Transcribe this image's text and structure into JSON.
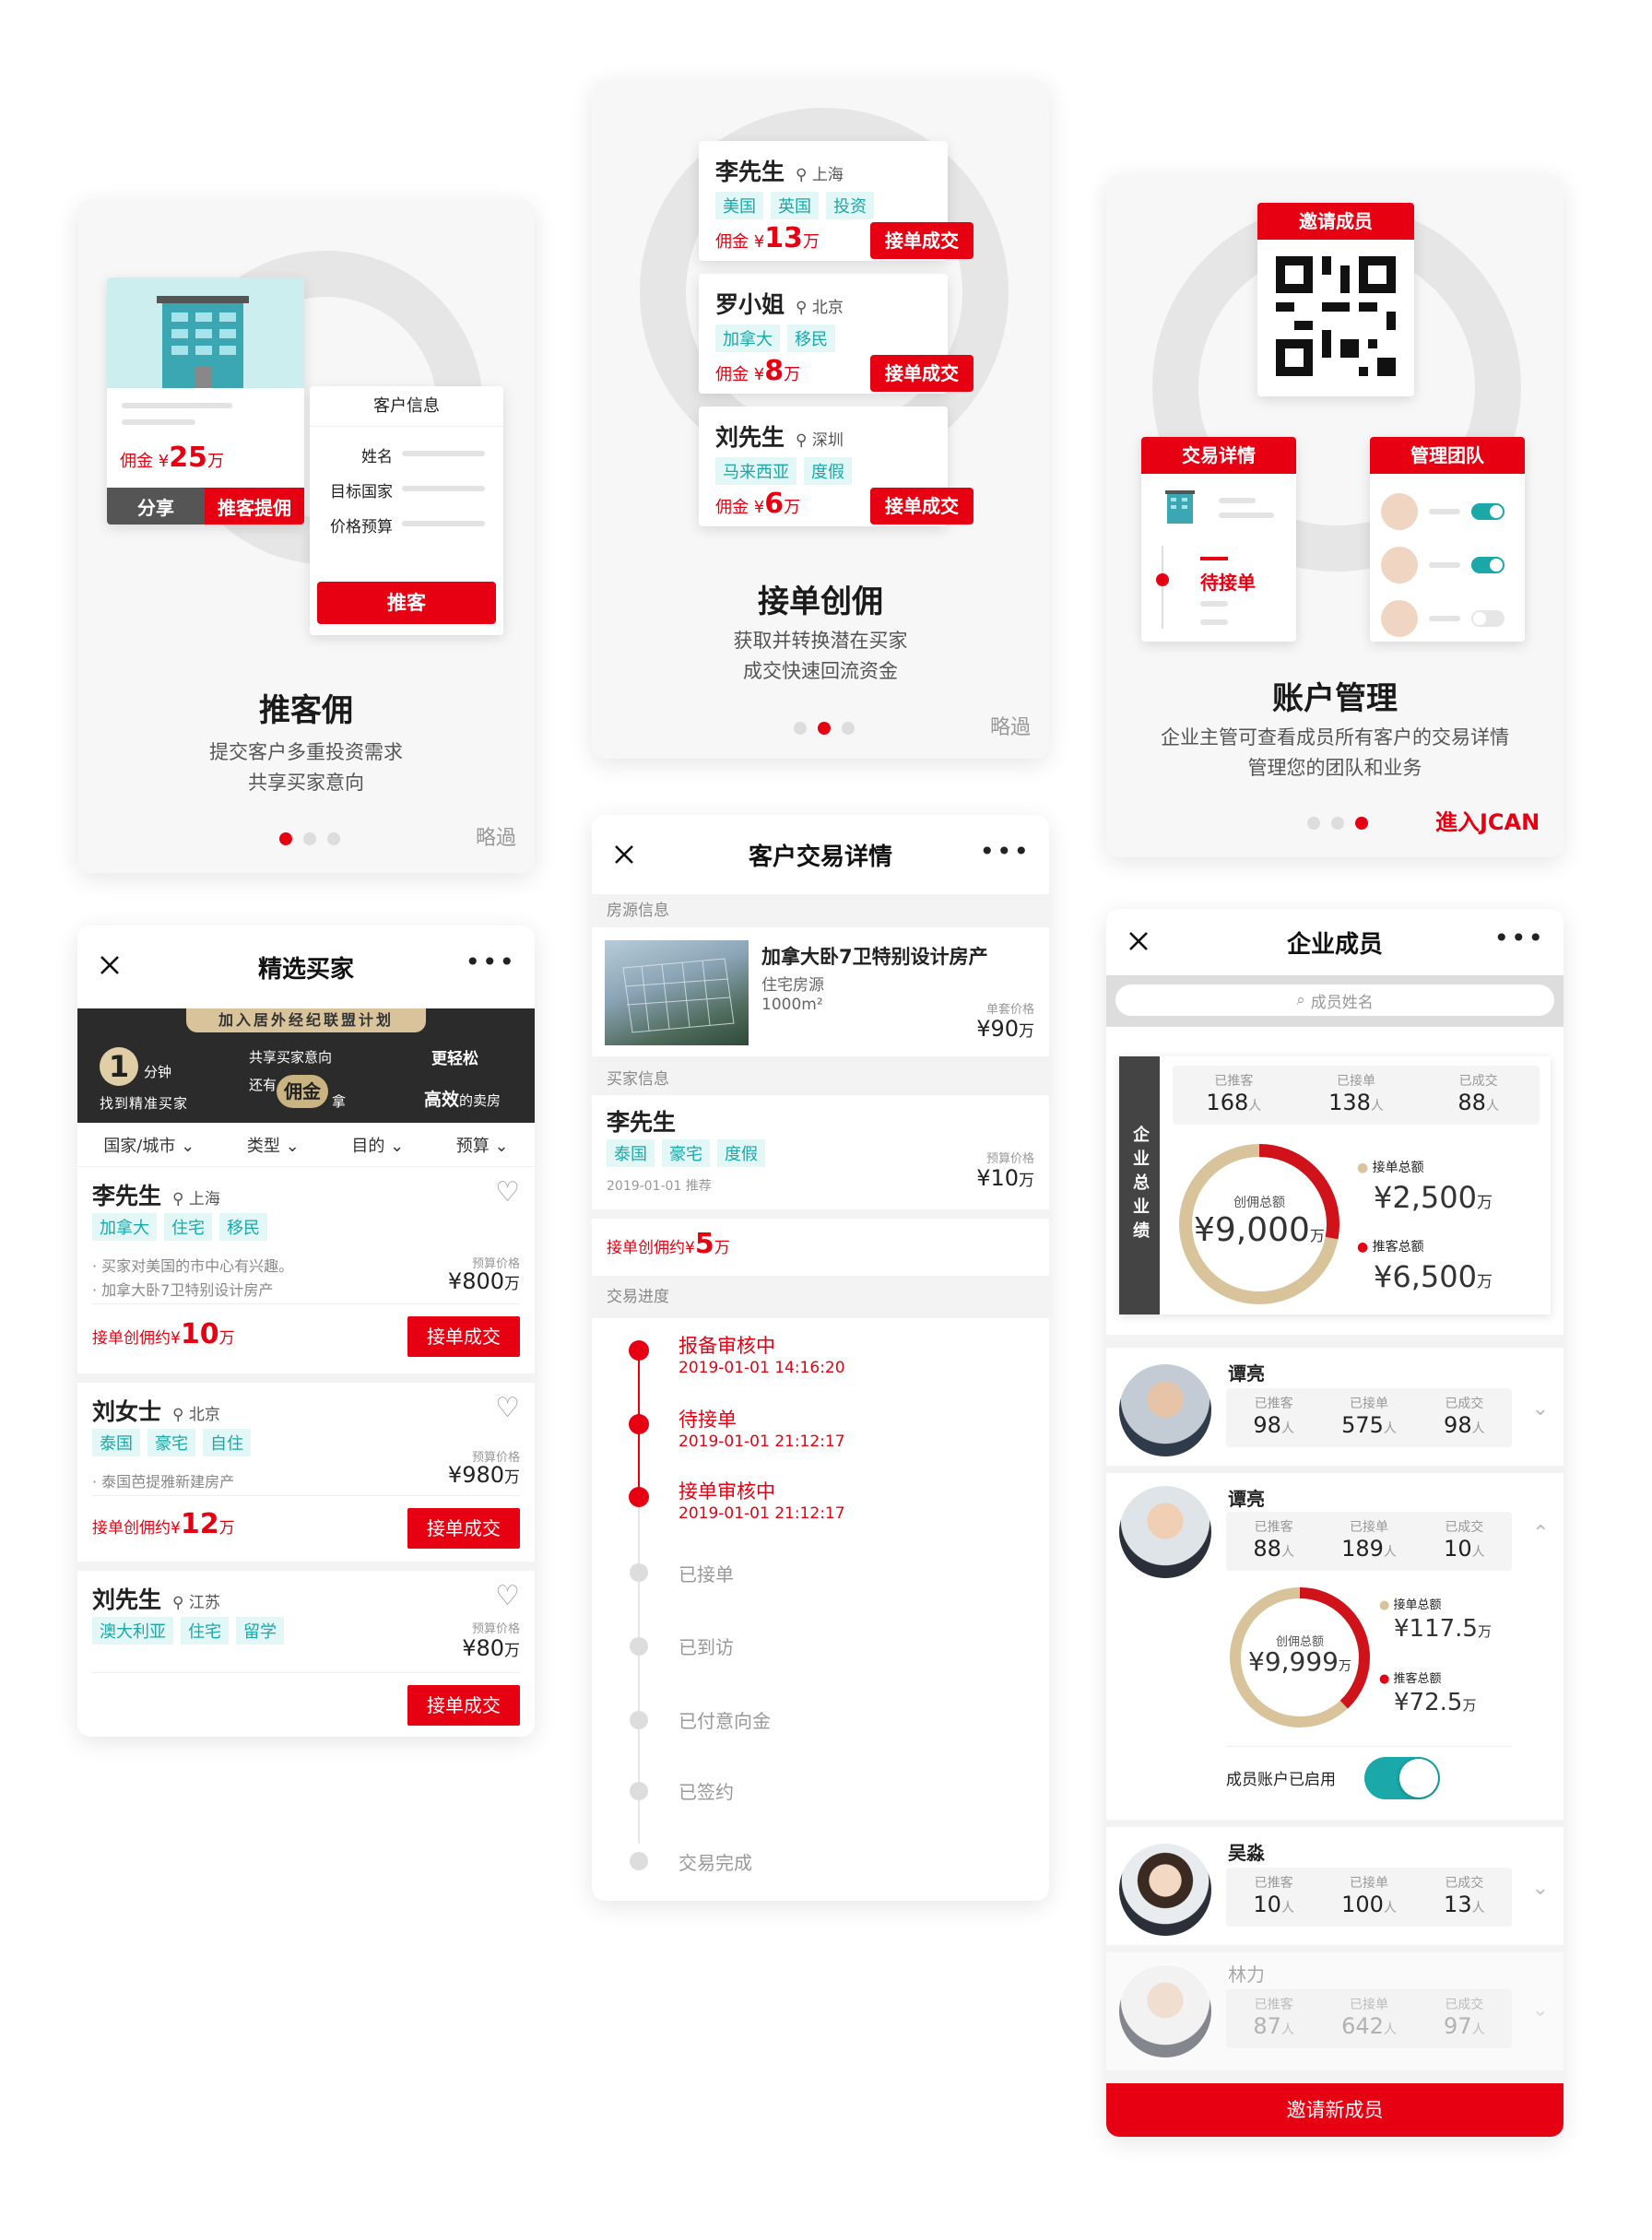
{
  "onb1": {
    "commission_prefix": "佣金 ¥",
    "commission_value": "25",
    "commission_unit": "万",
    "share_label": "分享",
    "recommend_label": "推客提佣",
    "info_title": "客户信息",
    "fields": [
      "姓名",
      "目标国家",
      "价格预算"
    ],
    "submit_label": "推客",
    "title": "推客佣",
    "desc1": "提交客户多重投资需求",
    "desc2": "共享买家意向",
    "skip": "略過"
  },
  "onb2": {
    "cards": [
      {
        "name": "李先生",
        "city": "上海",
        "tags": [
          "美国",
          "英国",
          "投资"
        ],
        "amount": "13"
      },
      {
        "name": "罗小姐",
        "city": "北京",
        "tags": [
          "加拿大",
          "移民"
        ],
        "amount": "8"
      },
      {
        "name": "刘先生",
        "city": "深圳",
        "tags": [
          "马来西亚",
          "度假"
        ],
        "amount": "6"
      }
    ],
    "commission_prefix": "佣金 ¥",
    "unit": "万",
    "btn_label": "接单成交",
    "title": "接单创佣",
    "desc1": "获取并转换潜在买家",
    "desc2": "成交快速回流资金",
    "skip": "略過"
  },
  "onb3": {
    "invite_label": "邀请成员",
    "deal_label": "交易详情",
    "team_label": "管理团队",
    "pending_label": "待接单",
    "title": "账户管理",
    "desc1": "企业主管可查看成员所有客户的交易详情",
    "desc2": "管理您的团队和业务",
    "enter_label": "進入JCAN"
  },
  "buyers": {
    "title": "精选买家",
    "banner": {
      "top": "加入居外经纪联盟计划",
      "num": "1",
      "num_unit": "分钟",
      "l1": "找到精准买家",
      "m1": "共享买家意向",
      "m2": "还有",
      "m3": "佣金",
      "m4": "拿",
      "r1": "更轻松",
      "r2": "高效",
      "r3": "的卖房"
    },
    "filters": [
      "国家/城市",
      "类型",
      "目的",
      "预算"
    ],
    "items": [
      {
        "name": "李先生",
        "city": "上海",
        "tags": [
          "加拿大",
          "住宅",
          "移民"
        ],
        "notes": [
          "· 买家对美国的市中心有兴趣。",
          "· 加拿大卧7卫特别设计房产"
        ],
        "budget_label": "预算价格",
        "budget": "¥800",
        "unit": "万",
        "commission_label": "接单创佣约¥",
        "commission": "10",
        "btn": "接单成交"
      },
      {
        "name": "刘女士",
        "city": "北京",
        "tags": [
          "泰国",
          "豪宅",
          "自住"
        ],
        "notes": [
          "· 泰国芭提雅新建房产"
        ],
        "budget_label": "预算价格",
        "budget": "¥980",
        "unit": "万",
        "commission_label": "接单创佣约¥",
        "commission": "12",
        "btn": "接单成交"
      },
      {
        "name": "刘先生",
        "city": "江苏",
        "tags": [
          "澳大利亚",
          "住宅",
          "留学"
        ],
        "notes": [],
        "budget_label": "预算价格",
        "budget": "¥80",
        "unit": "万",
        "btn": "接单成交"
      }
    ]
  },
  "deal": {
    "title": "客户交易详情",
    "property_section": "房源信息",
    "property_name": "加拿大卧7卫特别设计房产",
    "property_type": "住宅房源",
    "property_area": "1000m²",
    "unit_price_label": "单套价格",
    "unit_price": "¥90",
    "unit_price_unit": "万",
    "buyer_section": "买家信息",
    "buyer_name": "李先生",
    "buyer_tags": [
      "泰国",
      "豪宅",
      "度假"
    ],
    "buyer_date": "2019-01-01 推荐",
    "budget_label": "预算价格",
    "budget": "¥10",
    "budget_unit": "万",
    "commission_label": "接单创佣约¥",
    "commission": "5",
    "commission_unit": "万",
    "progress_section": "交易进度",
    "steps": [
      {
        "label": "报备审核中",
        "time": "2019-01-01  14:16:20",
        "done": true
      },
      {
        "label": "待接单",
        "time": "2019-01-01  21:12:17",
        "done": true
      },
      {
        "label": "接单审核中",
        "time": "2019-01-01  21:12:17",
        "done": true
      },
      {
        "label": "已接单",
        "done": false
      },
      {
        "label": "已到访",
        "done": false
      },
      {
        "label": "已付意向金",
        "done": false
      },
      {
        "label": "已签约",
        "done": false
      },
      {
        "label": "交易完成",
        "done": false
      }
    ]
  },
  "members": {
    "title": "企业成员",
    "search_placeholder": "成员姓名",
    "side_label": "企业总业绩",
    "stat_labels": [
      "已推客",
      "已接单",
      "已成交"
    ],
    "unit_people": "人",
    "summary": {
      "values": [
        "168",
        "138",
        "88"
      ],
      "total_label": "创佣总额",
      "total": "¥9,000",
      "total_unit": "万",
      "accept_label": "接单总额",
      "accept": "¥2,500",
      "refer_label": "推客总额",
      "refer": "¥6,500",
      "unit": "万",
      "accept_share": 0.28
    },
    "list": [
      {
        "name": "谭亮",
        "values": [
          "98",
          "575",
          "98"
        ]
      },
      {
        "name": "谭亮",
        "values": [
          "88",
          "189",
          "10"
        ],
        "expanded": true
      },
      {
        "name": "吴淼",
        "values": [
          "10",
          "100",
          "13"
        ]
      },
      {
        "name": "林力",
        "values": [
          "87",
          "642",
          "97"
        ]
      }
    ],
    "expanded": {
      "total_label": "创佣总额",
      "total": "¥9,999",
      "total_unit": "万",
      "accept_label": "接单总额",
      "accept": "¥117.5",
      "refer_label": "推客总额",
      "refer": "¥72.5",
      "unit": "万",
      "accept_share": 0.38,
      "enabled_label": "成员账户已启用"
    },
    "invite_btn": "邀请新成员"
  },
  "colors": {
    "brand": "#e60012",
    "teal": "#1aa8a8",
    "gold": "#d8c39a"
  }
}
